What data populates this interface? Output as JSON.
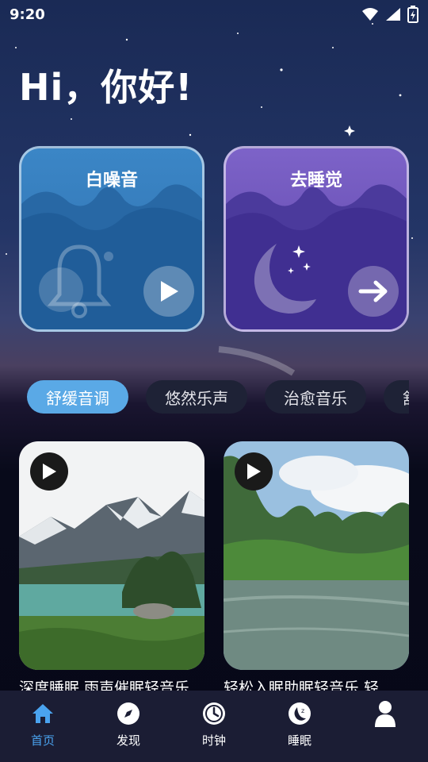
{
  "status": {
    "time": "9:20"
  },
  "greeting": "Hi，你好!",
  "cards": [
    {
      "title": "白噪音",
      "icon": "bell-icon",
      "action_icon": "play-icon"
    },
    {
      "title": "去睡觉",
      "icon": "moon-icon",
      "action_icon": "arrow-right-icon"
    }
  ],
  "tabs": [
    "舒缓音调",
    "悠然乐声",
    "治愈音乐",
    "舒"
  ],
  "active_tab": 0,
  "media": [
    {
      "caption": "深度睡眠 雨声催眠轻音乐",
      "scene": "mountain-lake"
    },
    {
      "caption": "轻松入眠助眠轻音乐 轻",
      "scene": "river-hills"
    }
  ],
  "nav": [
    {
      "label": "首页",
      "icon": "home-icon"
    },
    {
      "label": "发现",
      "icon": "compass-icon"
    },
    {
      "label": "时钟",
      "icon": "clock-icon"
    },
    {
      "label": "睡眠",
      "icon": "sleep-icon"
    },
    {
      "label": "",
      "icon": "profile-icon"
    }
  ],
  "colors": {
    "accent": "#5aa9e6",
    "nav_active": "#4aa3ef",
    "noise_card": "#3b86c6",
    "sleep_card": "#7d63c8"
  }
}
